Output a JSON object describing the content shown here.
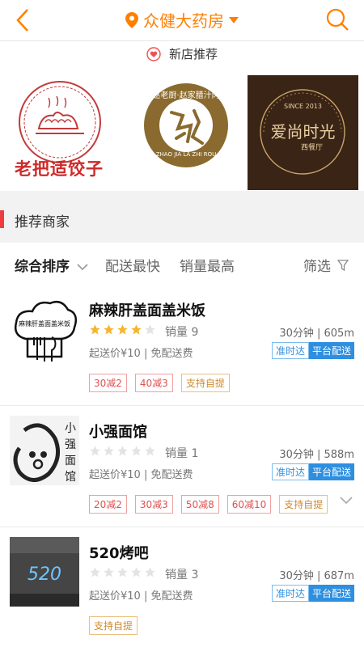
{
  "header": {
    "title": "众健大药房"
  },
  "new_stores": {
    "heading": "新店推荐",
    "items": [
      {
        "brand": "老把适饺子"
      },
      {
        "brand": "赵老厨·赵家腊汁肉",
        "sub": "ZHAO JIA LA ZHI ROU"
      },
      {
        "brand": "爱尚时光",
        "since": "SINCE 2013",
        "type": "西餐厅"
      }
    ]
  },
  "section_title": "推荐商家",
  "sort": {
    "overall": "综合排序",
    "fastest": "配送最快",
    "sales": "销量最高",
    "filter": "筛选"
  },
  "shops": [
    {
      "name": "麻辣肝盖面盖米饭",
      "logo_text": "麻辣肝盖面盖米饭",
      "rating": 4,
      "sales": "销量 9",
      "time_distance": "30分钟 | 605m",
      "min_price": "起送价¥10 | 免配送费",
      "on_time": "准时达",
      "platform": "平台配送",
      "promos": [
        "30减2",
        "40减3"
      ],
      "pickup": "支持自提"
    },
    {
      "name": "小强面馆",
      "logo_text": "小强面馆",
      "rating": 0,
      "sales": "销量 1",
      "time_distance": "30分钟 | 588m",
      "min_price": "起送价¥10 | 免配送费",
      "on_time": "准时达",
      "platform": "平台配送",
      "promos": [
        "20减2",
        "30减3",
        "50减8",
        "60减10"
      ],
      "pickup": "支持自提"
    },
    {
      "name": "520烤吧",
      "logo_text": "520",
      "rating": 0,
      "sales": "销量 3",
      "time_distance": "30分钟 | 687m",
      "min_price": "起送价¥10 | 免配送费",
      "on_time": "准时达",
      "platform": "平台配送",
      "promos": [],
      "pickup": "支持自提"
    }
  ],
  "colors": {
    "accent": "#ff7f00",
    "blue": "#2e8fe0",
    "red": "#f03c3c",
    "star": "#f5b52e"
  }
}
